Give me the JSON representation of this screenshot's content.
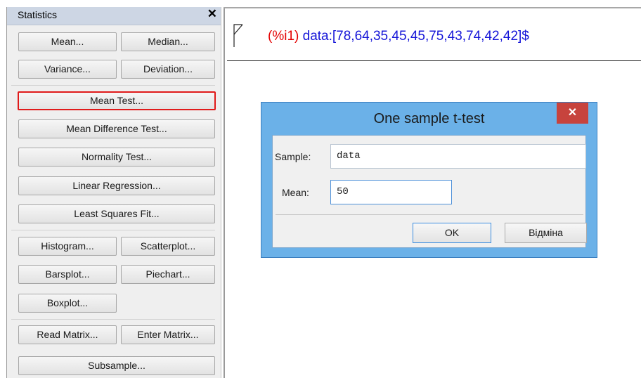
{
  "panel": {
    "title": "Statistics",
    "close_glyph": "✕",
    "buttons": {
      "mean": "Mean...",
      "median": "Median...",
      "variance": "Variance...",
      "deviation": "Deviation...",
      "mean_test": "Mean Test...",
      "mean_difference_test": "Mean Difference Test...",
      "normality_test": "Normality Test...",
      "linear_regression": "Linear Regression...",
      "least_squares_fit": "Least Squares Fit...",
      "histogram": "Histogram...",
      "scatterplot": "Scatterplot...",
      "barsplot": "Barsplot...",
      "piechart": "Piechart...",
      "boxplot": "Boxplot...",
      "read_matrix": "Read Matrix...",
      "enter_matrix": "Enter Matrix...",
      "subsample": "Subsample..."
    },
    "selected": "Mean Test..."
  },
  "worksheet": {
    "input_label": "(%i1)",
    "input_expr": "data:[78,64,35,45,45,75,43,74,42,42]$"
  },
  "dialog": {
    "title": "One sample t-test",
    "close_glyph": "✕",
    "sample_label": "Sample:",
    "sample_value": "data",
    "mean_label": "Mean:",
    "mean_value": "50",
    "ok_label": "OK",
    "cancel_label": "Відміна"
  },
  "colors": {
    "input_label": "#e40000",
    "input_expr": "#1515d8",
    "selected_border": "#e01a1a",
    "dialog_frame": "#6bb1e8",
    "close_button": "#c7433d"
  }
}
